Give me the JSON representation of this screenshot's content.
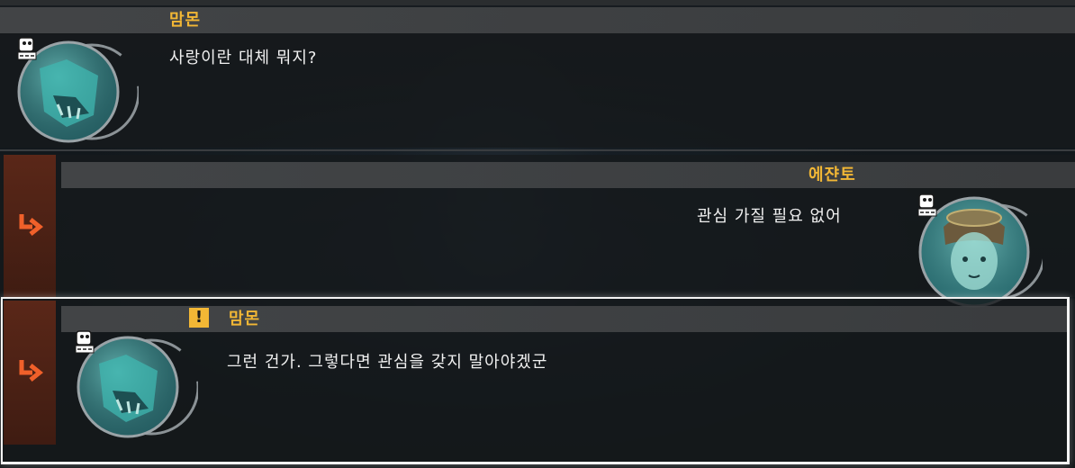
{
  "dialogue": [
    {
      "speaker": "맘몬",
      "text": "사랑이란 대체 뭐지?",
      "portrait": "mammon-portrait",
      "badge": "digimon-badge-icon",
      "is_reply": false
    },
    {
      "speaker": "에쟌토",
      "text": "관심 가질 필요 없어",
      "portrait": "ejanto-portrait",
      "badge": "digimon-badge-icon",
      "is_reply": true
    },
    {
      "speaker": "맘몬",
      "text": "그런 건가. 그렇다면 관심을 갖지 말아야겠군",
      "portrait": "mammon-portrait",
      "badge": "digimon-badge-icon",
      "is_reply": true,
      "selected": true,
      "alert_icon": "exclamation-icon",
      "alert_glyph": "!"
    }
  ],
  "colors": {
    "speaker_name": "#f2b735",
    "reply_strip": "#5a2718",
    "reply_arrow": "#f0602a",
    "selection_border": "#f3f3f3"
  }
}
